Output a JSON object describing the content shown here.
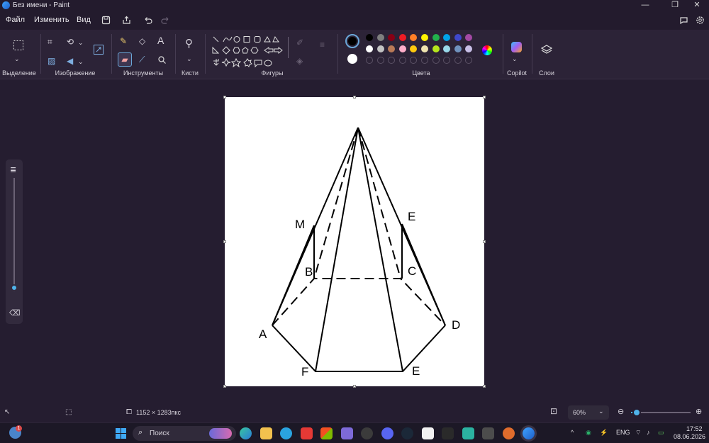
{
  "window": {
    "title": "Без имени - Paint",
    "minimize": "—",
    "maximize": "❐",
    "close": "✕"
  },
  "menu": {
    "file": "Файл",
    "edit": "Изменить",
    "view": "Вид"
  },
  "ribbon": {
    "groups": {
      "selection": "Выделение",
      "image": "Изображение",
      "tools": "Инструменты",
      "brushes": "Кисти",
      "shapes": "Фигуры",
      "colors": "Цвета",
      "copilot": "Copilot",
      "layers": "Слои"
    },
    "text_tool": "A",
    "palette_row1": [
      "#000000",
      "#7f7f7f",
      "#880015",
      "#ed1c24",
      "#ff7f27",
      "#fff200",
      "#22b14c",
      "#00a2e8",
      "#3f48cc",
      "#a349a4"
    ],
    "palette_row2": [
      "#ffffff",
      "#c3c3c3",
      "#b97a57",
      "#ffaec9",
      "#ffc90e",
      "#efe4b0",
      "#b5e61d",
      "#99d9ea",
      "#7092be",
      "#c8bfe7"
    ],
    "primary_color": "#000000",
    "secondary_color": "#ffffff"
  },
  "drawing": {
    "labels": {
      "M": "M",
      "E_top": "E",
      "B": "B",
      "C": "C",
      "A": "A",
      "D": "D",
      "F": "F",
      "E_bottom": "E"
    }
  },
  "status": {
    "dimensions": "1152 × 1283пкс",
    "zoom": "60%",
    "zoom_level_fraction": 0.1
  },
  "taskbar": {
    "search_placeholder": "Поиск",
    "language": "ENG",
    "time": "17:52",
    "date": "08.06.2026",
    "notification_count": "1"
  }
}
